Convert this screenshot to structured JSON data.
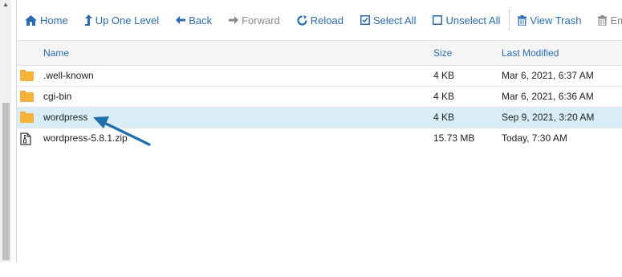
{
  "toolbar": {
    "home": "Home",
    "up_one_level": "Up One Level",
    "back": "Back",
    "forward": "Forward",
    "reload": "Reload",
    "select_all": "Select All",
    "unselect_all": "Unselect All",
    "view_trash": "View Trash",
    "empty_trash": "Empty Tra"
  },
  "columns": {
    "name": "Name",
    "size": "Size",
    "last_modified": "Last Modified"
  },
  "files": [
    {
      "name": ".well-known",
      "size": "4 KB",
      "modified": "Mar 6, 2021, 6:37 AM",
      "type": "folder",
      "selected": false
    },
    {
      "name": "cgi-bin",
      "size": "4 KB",
      "modified": "Mar 6, 2021, 6:36 AM",
      "type": "folder",
      "selected": false
    },
    {
      "name": "wordpress",
      "size": "4 KB",
      "modified": "Sep 9, 2021, 3:20 AM",
      "type": "folder",
      "selected": true
    },
    {
      "name": "wordpress-5.8.1.zip",
      "size": "15.73 MB",
      "modified": "Today, 7:30 AM",
      "type": "zip",
      "selected": false
    }
  ],
  "colors": {
    "accent": "#2b6cb0",
    "selected_row": "#d9edf7",
    "folder": "#f5b33c",
    "arrow": "#1f6fae"
  },
  "icons": [
    "home-icon",
    "level-up-icon",
    "arrow-left-icon",
    "arrow-right-icon",
    "refresh-icon",
    "checkbox-checked-icon",
    "checkbox-empty-icon",
    "trash-icon",
    "folder-icon",
    "zip-file-icon",
    "annotation-arrow"
  ]
}
